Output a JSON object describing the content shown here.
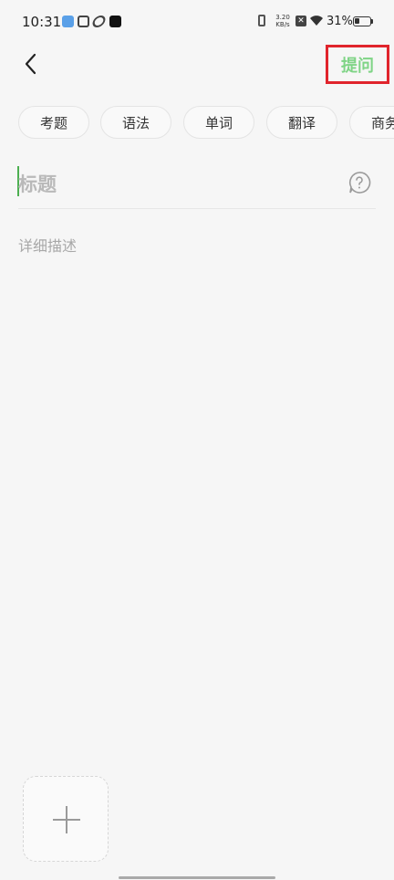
{
  "status_bar": {
    "time": "10:31",
    "net_speed_value": "3.20",
    "net_speed_unit": "KB/s",
    "battery": "31%"
  },
  "header": {
    "back_icon": "chevron-left-icon",
    "ask_label": "提问",
    "accent_color": "#7fd486",
    "highlight_color": "#e0242c"
  },
  "categories": [
    "考题",
    "语法",
    "单词",
    "翻译",
    "商务"
  ],
  "form": {
    "title_placeholder": "标题",
    "description_placeholder": "详细描述",
    "help_icon": "question-bubble-icon",
    "add_image_icon": "plus-icon"
  }
}
